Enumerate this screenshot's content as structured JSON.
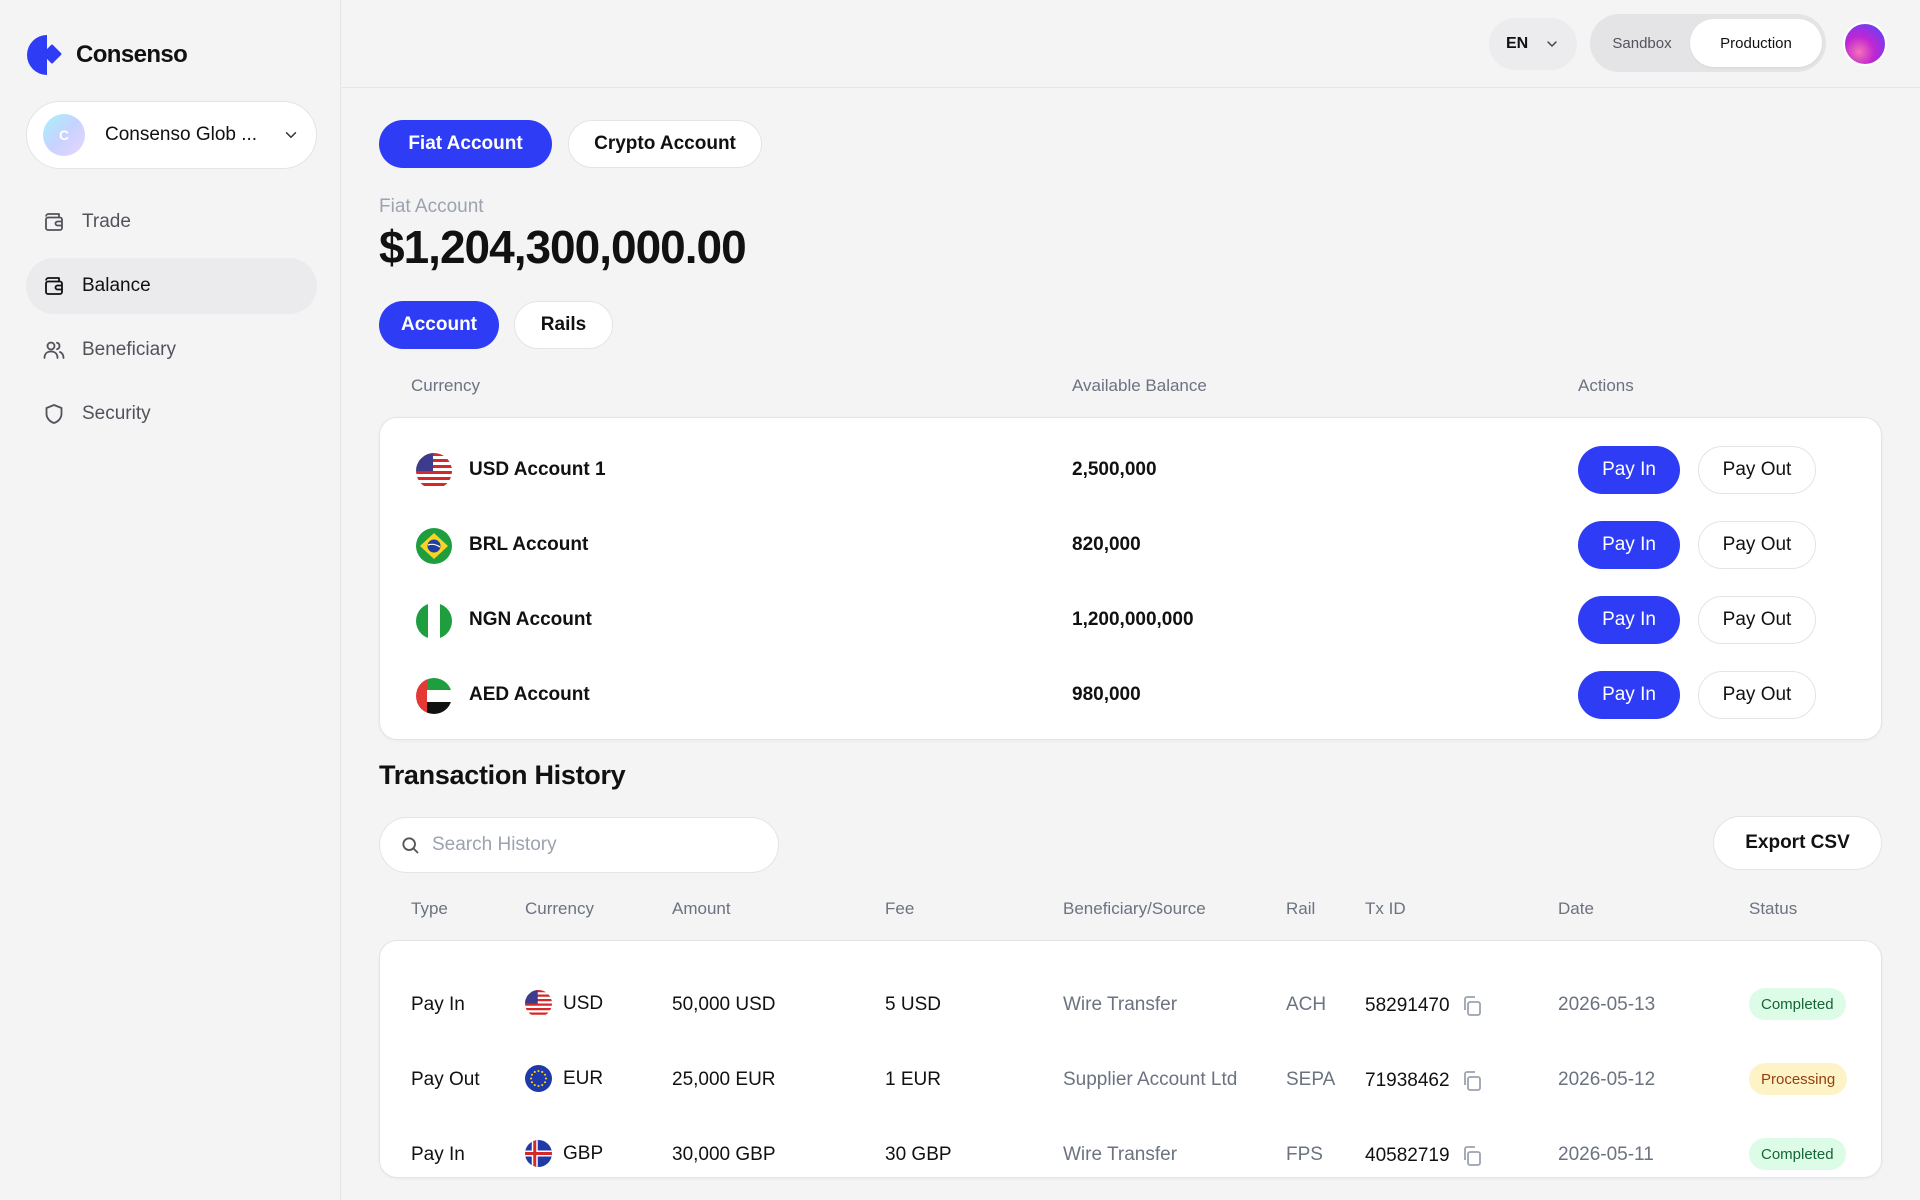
{
  "brand": {
    "name": "Consenso"
  },
  "org": {
    "initial": "C",
    "name": "Consenso Glob ..."
  },
  "nav": [
    {
      "label": "Trade",
      "icon": "wallet-icon",
      "active": false
    },
    {
      "label": "Balance",
      "icon": "wallet-icon",
      "active": true
    },
    {
      "label": "Beneficiary",
      "icon": "users-icon",
      "active": false
    },
    {
      "label": "Security",
      "icon": "shield-icon",
      "active": false
    }
  ],
  "topbar": {
    "language": "EN",
    "env_options": [
      "Sandbox",
      "Production"
    ],
    "env_selected": "Production"
  },
  "account_tabs": {
    "fiat": "Fiat Account",
    "crypto": "Crypto Account",
    "selected": "Fiat Account"
  },
  "summary": {
    "label": "Fiat Account",
    "total": "$1,204,300,000.00"
  },
  "view_tabs": {
    "account": "Account",
    "rails": "Rails",
    "selected": "Account"
  },
  "accounts_table": {
    "headers": {
      "currency": "Currency",
      "balance": "Available Balance",
      "actions": "Actions"
    },
    "pay_in_label": "Pay In",
    "pay_out_label": "Pay Out",
    "rows": [
      {
        "flag": "us-flag-icon",
        "name": "USD Account 1",
        "balance": "2,500,000"
      },
      {
        "flag": "br-flag-icon",
        "name": "BRL Account",
        "balance": "820,000"
      },
      {
        "flag": "ng-flag-icon",
        "name": "NGN Account",
        "balance": "1,200,000,000"
      },
      {
        "flag": "ae-flag-icon",
        "name": "AED Account",
        "balance": "980,000"
      }
    ]
  },
  "history": {
    "title": "Transaction History",
    "search_placeholder": "Search History",
    "export_label": "Export CSV",
    "headers": {
      "type": "Type",
      "currency": "Currency",
      "amount": "Amount",
      "fee": "Fee",
      "beneficiary": "Beneficiary/Source",
      "rail": "Rail",
      "txid": "Tx ID",
      "date": "Date",
      "status": "Status"
    },
    "rows": [
      {
        "type": "Pay In",
        "flag": "us-flag-icon",
        "currency": "USD",
        "amount": "50,000 USD",
        "fee": "5 USD",
        "beneficiary": "Wire Transfer",
        "rail": "ACH",
        "txid": "58291470",
        "date": "2026-05-13",
        "status": "Completed"
      },
      {
        "type": "Pay Out",
        "flag": "eu-flag-icon",
        "currency": "EUR",
        "amount": "25,000 EUR",
        "fee": "1 EUR",
        "beneficiary": "Supplier Account Ltd",
        "rail": "SEPA",
        "txid": "71938462",
        "date": "2026-05-12",
        "status": "Processing"
      },
      {
        "type": "Pay In",
        "flag": "is-flag-icon",
        "currency": "GBP",
        "amount": "30,000 GBP",
        "fee": "30 GBP",
        "beneficiary": "Wire Transfer",
        "rail": "FPS",
        "txid": "40582719",
        "date": "2026-05-11",
        "status": "Completed"
      }
    ]
  },
  "colors": {
    "accent": "#2e3cf5",
    "completed_bg": "#dcfce7",
    "processing_bg": "#fef3c7"
  }
}
